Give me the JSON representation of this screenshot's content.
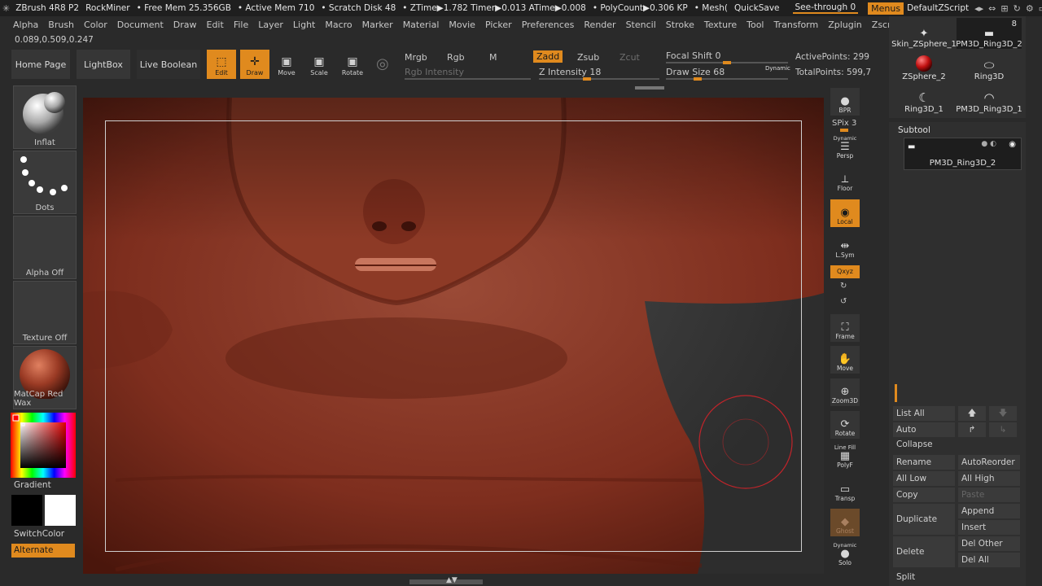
{
  "titlebar": {
    "app": "ZBrush 4R8 P2",
    "project": "RockMiner",
    "free_mem": "• Free Mem 25.356GB",
    "active_mem": "• Active Mem 710",
    "scratch": "• Scratch Disk 48",
    "ztime": "• ZTime▶1.782 Timer▶0.013 ATime▶0.008",
    "polycount": "• PolyCount▶0.306 KP",
    "mesh": "• Mesh(",
    "quicksave": "QuickSave",
    "seethrough": "See-through  0",
    "menus": "Menus",
    "script": "DefaultZScript"
  },
  "menubar": [
    "Alpha",
    "Brush",
    "Color",
    "Document",
    "Draw",
    "Edit",
    "File",
    "Layer",
    "Light",
    "Macro",
    "Marker",
    "Material",
    "Movie",
    "Picker",
    "Preferences",
    "Render",
    "Stencil",
    "Stroke",
    "Texture",
    "Tool",
    "Transform",
    "Zplugin",
    "Zscript"
  ],
  "coords": "0.089,0.509,0.247",
  "shelf": {
    "home_page": "Home Page",
    "lightbox": "LightBox",
    "live_boolean": "Live Boolean",
    "edit": "Edit",
    "draw": "Draw",
    "move": "Move",
    "scale": "Scale",
    "rotate": "Rotate",
    "mrgb": "Mrgb",
    "rgb": "Rgb",
    "m": "M",
    "rgb_intensity": "Rgb Intensity",
    "zadd": "Zadd",
    "zsub": "Zsub",
    "zcut": "Zcut",
    "z_intensity": "Z Intensity 18",
    "focal_shift": "Focal Shift 0",
    "draw_size": "Draw Size 68",
    "dynamic": "Dynamic",
    "active_points": "ActivePoints: 299",
    "total_points": "TotalPoints: 599,7"
  },
  "left": {
    "brush": "Inflat",
    "stroke": "Dots",
    "alpha": "Alpha Off",
    "texture": "Texture Off",
    "material": "MatCap Red Wax",
    "gradient": "Gradient",
    "switchcolor": "SwitchColor",
    "alternate": "Alternate"
  },
  "dock": {
    "bpr": "BPR",
    "spix": "SPix 3",
    "persp": "Persp",
    "dynamic": "Dynamic",
    "floor": "Floor",
    "local": "Local",
    "lsym": "L.Sym",
    "xyz": "Qxyz",
    "frame": "Frame",
    "move": "Move",
    "zoom3d": "Zoom3D",
    "rotate": "Rotate",
    "linefill": "Line Fill",
    "polyf": "PolyF",
    "transp": "Transp",
    "ghost": "Ghost",
    "solo_dynamic": "Dynamic",
    "solo": "Solo"
  },
  "tool": {
    "items": [
      {
        "label": "Skin_ZSphere_1"
      },
      {
        "label": "PM3D_Ring3D_2",
        "count": "8"
      },
      {
        "label": "ZSphere_2"
      },
      {
        "label": "Ring3D"
      },
      {
        "label": "Ring3D_1"
      },
      {
        "label": "PM3D_Ring3D_1"
      }
    ]
  },
  "subtool": {
    "title": "Subtool",
    "item": "PM3D_Ring3D_2",
    "list_all": "List All",
    "auto_collapse": "Auto Collapse",
    "rename": "Rename",
    "auto_reorder": "AutoReorder",
    "all_low": "All Low",
    "all_high": "All High",
    "copy": "Copy",
    "paste": "Paste",
    "duplicate": "Duplicate",
    "append": "Append",
    "insert": "Insert",
    "delete": "Delete",
    "del_other": "Del Other",
    "del_all": "Del All",
    "split": "Split"
  },
  "colors": {
    "accent": "#e08a1e",
    "background": "#2a2a2a",
    "clay": "#8a3a28"
  }
}
